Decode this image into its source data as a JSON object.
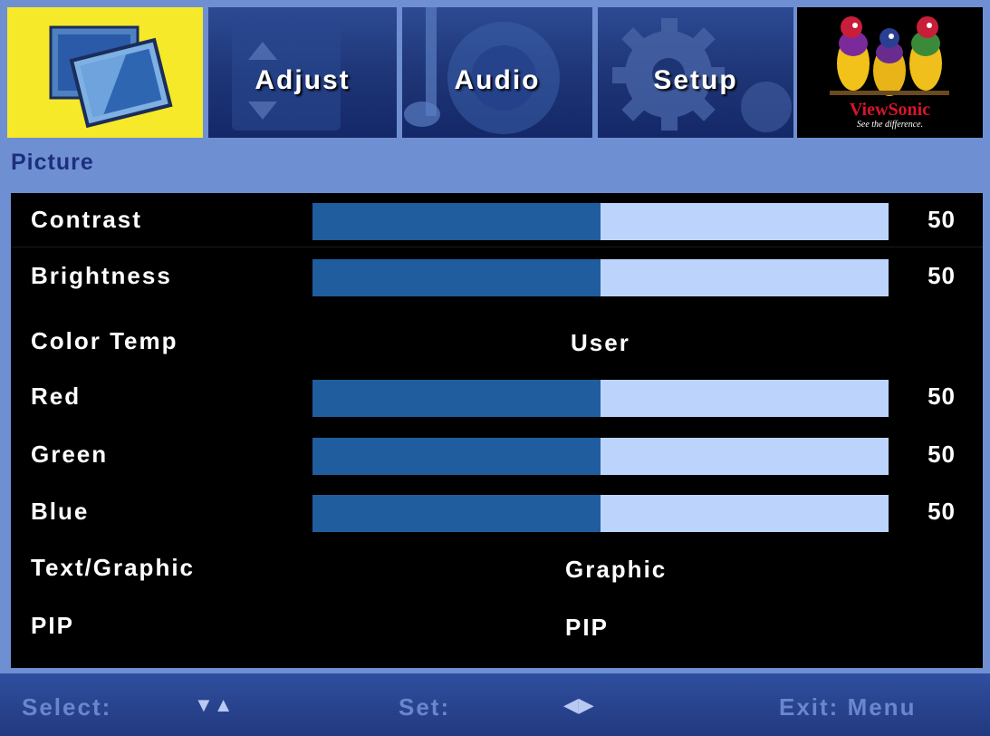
{
  "tabs": [
    {
      "id": "picture",
      "label": ""
    },
    {
      "id": "adjust",
      "label": "Adjust"
    },
    {
      "id": "audio",
      "label": "Audio"
    },
    {
      "id": "setup",
      "label": "Setup"
    }
  ],
  "brand": {
    "name": "ViewSonic",
    "tagline": "See the difference."
  },
  "section": {
    "title": "Picture"
  },
  "rows": {
    "contrast": {
      "label": "Contrast",
      "value": "50",
      "level": 0.5
    },
    "brightness": {
      "label": "Brightness",
      "value": "50",
      "level": 0.5
    },
    "color_temp": {
      "label": "Color Temp",
      "value": "User"
    },
    "red": {
      "label": "Red",
      "value": "50",
      "level": 0.5
    },
    "green": {
      "label": "Green",
      "value": "50",
      "level": 0.5
    },
    "blue": {
      "label": "Blue",
      "value": "50",
      "level": 0.5
    },
    "text_graphic": {
      "label": "Text/Graphic",
      "value": "Graphic"
    },
    "pip": {
      "label": "PIP",
      "value": "PIP"
    }
  },
  "footer": {
    "select_label": "Select:",
    "select_glyph": "▼▲",
    "set_label": "Set:",
    "set_glyph": "◀▶",
    "exit_label": "Exit: Menu"
  },
  "colors": {
    "selected_tab": "#f5e92a",
    "bar_fill": "#1f5d9f",
    "bar_track": "#bcd4fb",
    "panel": "#000000",
    "chrome": "#6f8fd3"
  },
  "icons": {
    "picture_tab": "picture-frames-icon",
    "adjust_tab": "up-down-arrows-icon",
    "audio_tab": "music-note-speaker-icon",
    "setup_tab": "gear-icon",
    "brand_logo": "viewsonic-birds-logo"
  }
}
